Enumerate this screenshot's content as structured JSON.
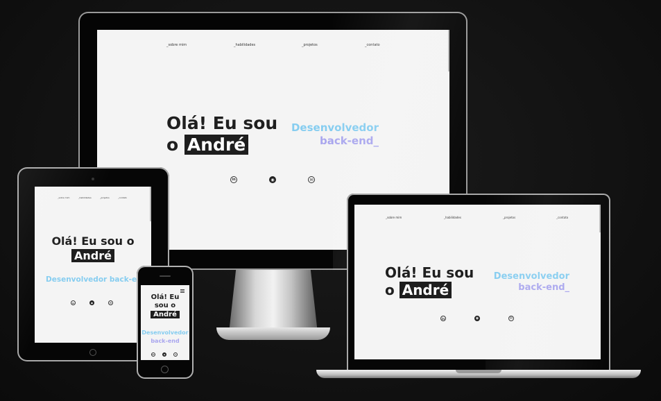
{
  "nav": {
    "about": "_sobre mim",
    "skills": "_habilidades",
    "projects": "_projetos",
    "contact": "_contato"
  },
  "hero": {
    "line1": "Olá! Eu sou",
    "line2_prefix": "o",
    "name": "André",
    "role_line1": "Desenvolvedor",
    "role_line2": "back-end_",
    "role_inline_tablet": "Desenvolvedor back-end_",
    "mobile_role_line2": "back-end"
  },
  "mobile": {
    "line1": "Olá! Eu",
    "line2": "sou o"
  },
  "social": {
    "linkedin_glyph": "in",
    "github_glyph": "◉",
    "email_glyph": "✉"
  },
  "colors": {
    "background": "#121212",
    "screen": "#f4f4f4",
    "name_highlight": "#1e1e1e",
    "role_blue": "#86cdf0",
    "role_purple": "#a9a6ee"
  }
}
